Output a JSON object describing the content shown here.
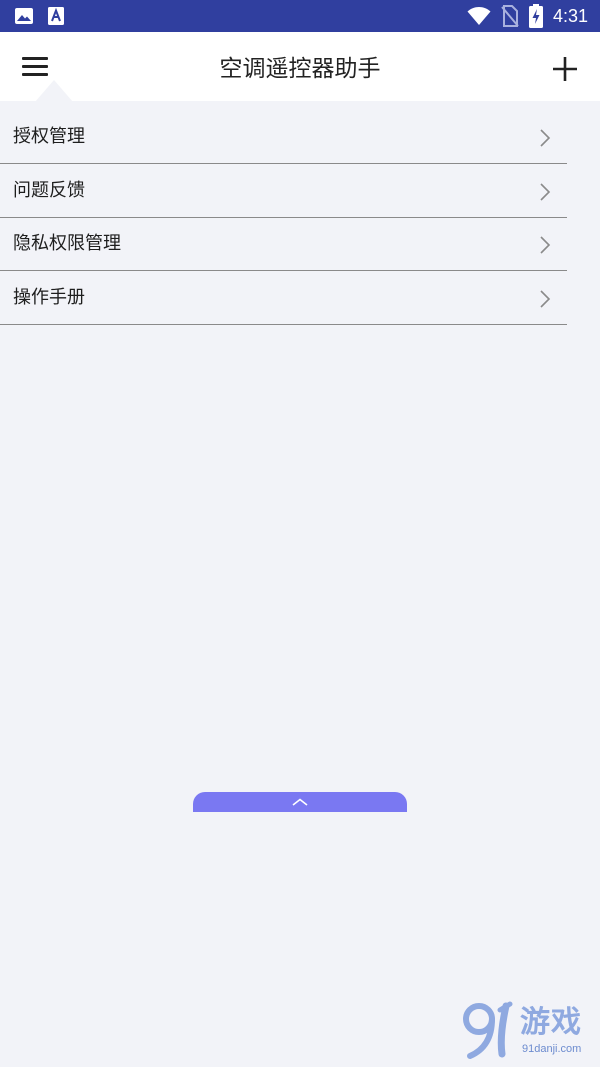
{
  "status_bar": {
    "time": "4:31",
    "left_icons": [
      "image-icon",
      "text-a-icon"
    ],
    "right_icons": [
      "wifi-icon",
      "no-sim-icon",
      "battery-charging-icon"
    ]
  },
  "header": {
    "title": "空调遥控器助手",
    "menu_icon": "hamburger-menu-icon",
    "add_icon": "plus-icon"
  },
  "menu": {
    "items": [
      {
        "label": "授权管理"
      },
      {
        "label": "问题反馈"
      },
      {
        "label": "隐私权限管理"
      },
      {
        "label": "操作手册"
      }
    ]
  },
  "pull_tab": {
    "icon": "chevron-up-icon"
  },
  "watermark": {
    "logo_text": "游戏",
    "url": "91danji.com"
  },
  "colors": {
    "status_bar": "#303f9f",
    "background": "#f2f3f8",
    "accent": "#7a78f2"
  }
}
